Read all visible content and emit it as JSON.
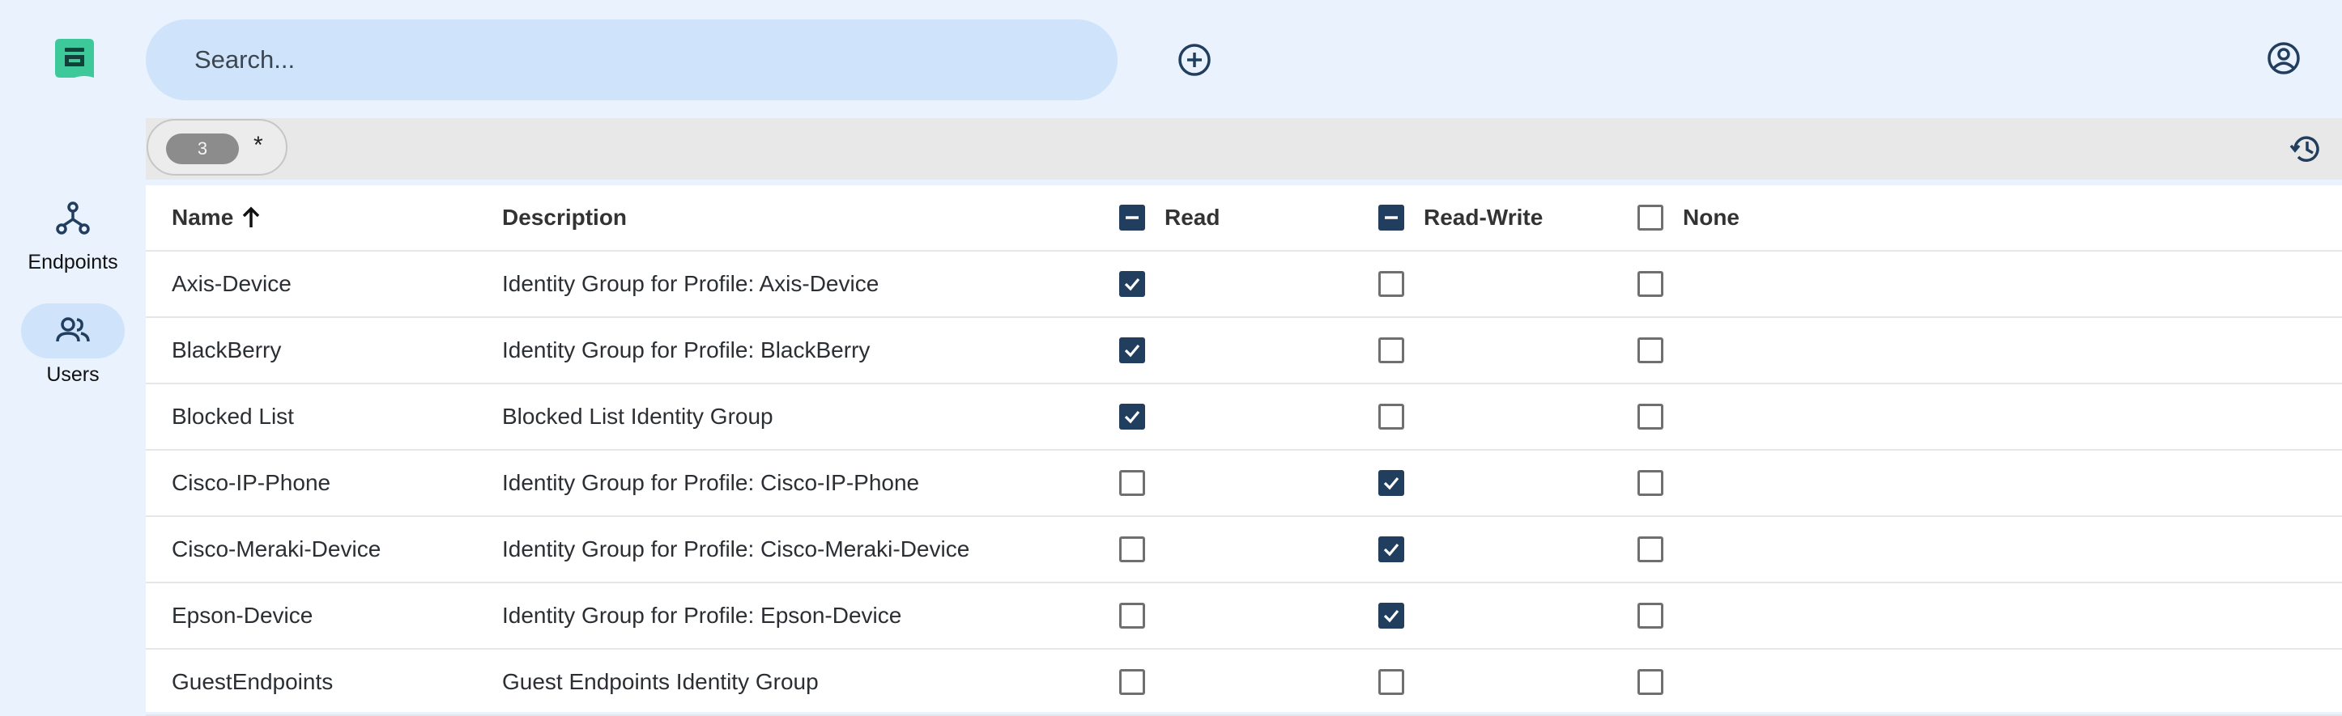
{
  "search": {
    "placeholder": "Search..."
  },
  "sidebar": {
    "items": [
      {
        "label": "Endpoints",
        "icon": "endpoints-icon",
        "active": false
      },
      {
        "label": "Users",
        "icon": "users-icon",
        "active": true
      }
    ]
  },
  "filter": {
    "count": "3",
    "symbol": "*"
  },
  "table": {
    "columns": {
      "name": "Name",
      "description": "Description",
      "read": "Read",
      "read_write": "Read-Write",
      "none": "None"
    },
    "header_state": {
      "read": "mixed",
      "read_write": "mixed",
      "none": "unchecked"
    },
    "rows": [
      {
        "name": "Axis-Device",
        "description": "Identity Group for Profile: Axis-Device",
        "read": true,
        "read_write": false,
        "none": false
      },
      {
        "name": "BlackBerry",
        "description": "Identity Group for Profile: BlackBerry",
        "read": true,
        "read_write": false,
        "none": false
      },
      {
        "name": "Blocked List",
        "description": "Blocked List Identity Group",
        "read": true,
        "read_write": false,
        "none": false
      },
      {
        "name": "Cisco-IP-Phone",
        "description": "Identity Group for Profile: Cisco-IP-Phone",
        "read": false,
        "read_write": true,
        "none": false
      },
      {
        "name": "Cisco-Meraki-Device",
        "description": "Identity Group for Profile: Cisco-Meraki-Device",
        "read": false,
        "read_write": true,
        "none": false
      },
      {
        "name": "Epson-Device",
        "description": "Identity Group for Profile: Epson-Device",
        "read": false,
        "read_write": true,
        "none": false
      },
      {
        "name": "GuestEndpoints",
        "description": "Guest Endpoints Identity Group",
        "read": false,
        "read_write": false,
        "none": false
      }
    ]
  },
  "colors": {
    "accent": "#213e5e",
    "logo": "#3ec99a",
    "search_bg": "#cfe3fb",
    "page_bg": "#eaf2fd"
  }
}
